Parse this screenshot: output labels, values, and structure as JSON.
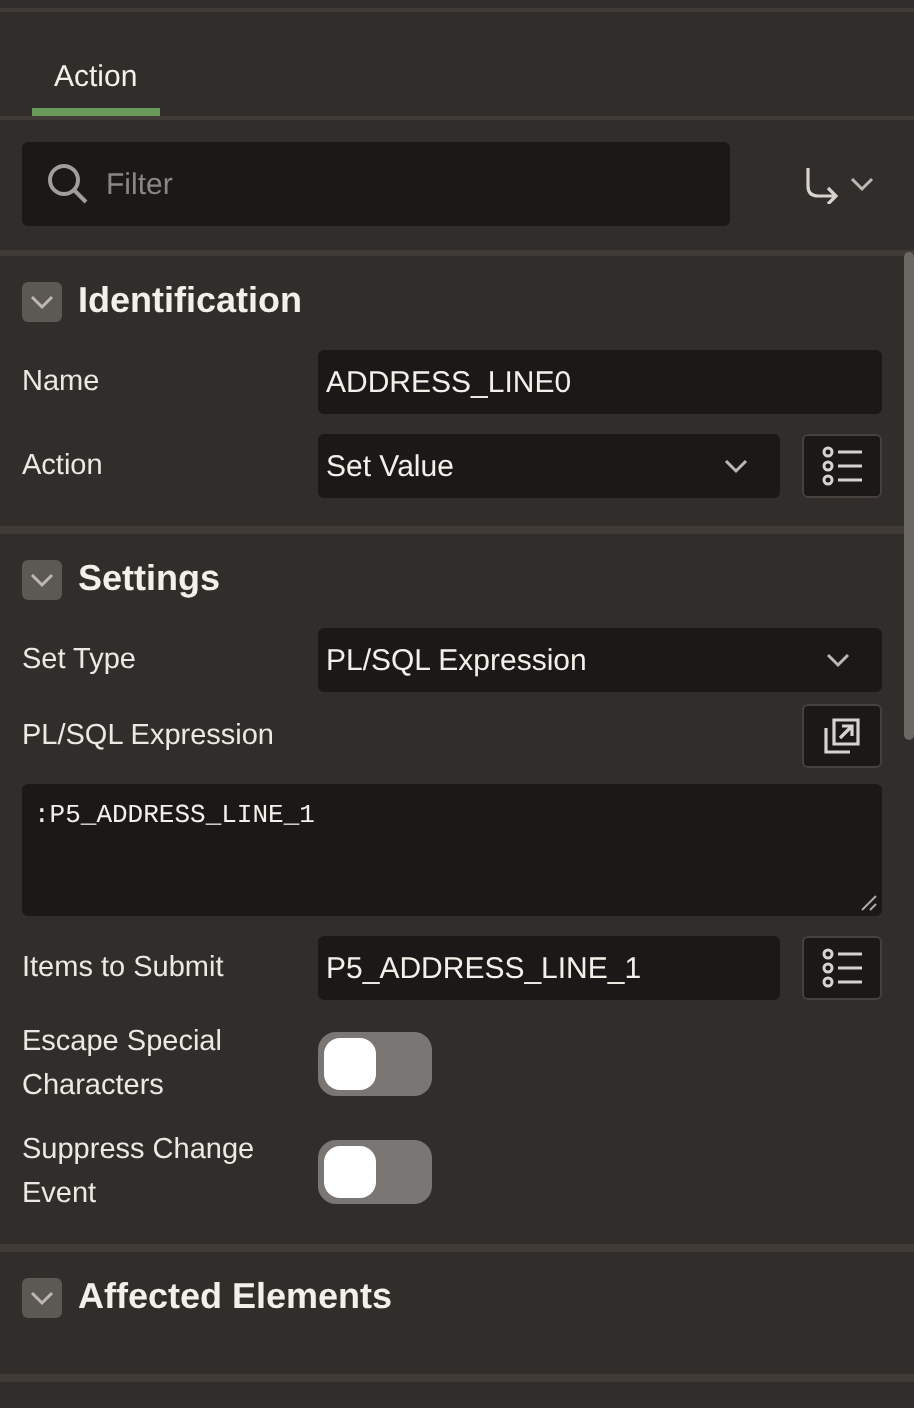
{
  "tabs": [
    {
      "label": "Action",
      "selected": true
    }
  ],
  "filter": {
    "placeholder": "Filter"
  },
  "sections": [
    {
      "title": "Identification",
      "expanded": true,
      "properties": [
        {
          "kind": "text",
          "label": "Name",
          "value": "ADDRESS_LINE0"
        },
        {
          "kind": "select",
          "label": "Action",
          "value": "Set Value",
          "button": {
            "kind": "list"
          }
        }
      ]
    },
    {
      "title": "Settings",
      "expanded": true,
      "properties": [
        {
          "kind": "select",
          "label": "Set Type",
          "value": "PL/SQL Expression"
        },
        {
          "kind": "code",
          "label": "PL/SQL Expression",
          "value": ":P5_ADDRESS_LINE_1",
          "button": {
            "kind": "expand"
          }
        },
        {
          "kind": "text",
          "label": "Items to Submit",
          "value": "P5_ADDRESS_LINE_1",
          "button": {
            "kind": "list"
          }
        },
        {
          "kind": "switch",
          "label": "Escape Special Characters",
          "on": false
        },
        {
          "kind": "switch",
          "label": "Suppress Change Event",
          "on": false
        }
      ]
    },
    {
      "title": "Affected Elements",
      "expanded": true
    }
  ]
}
